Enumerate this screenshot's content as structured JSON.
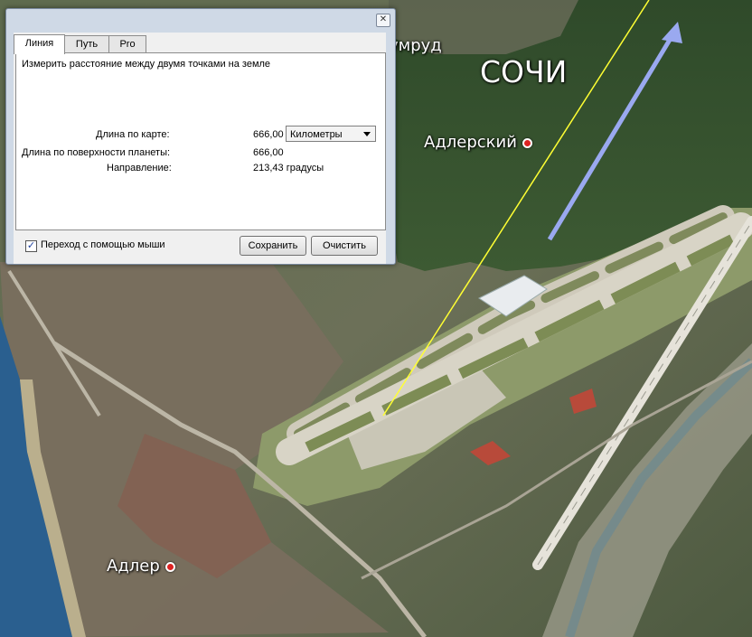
{
  "map": {
    "labels": {
      "city": "СОЧИ",
      "district": "Адлерский",
      "town": "Адлер",
      "partial": "умруд"
    },
    "colors": {
      "measure_line": "#ffff33",
      "arrow": "#9aa9f0",
      "sea": "#2a5f8f"
    }
  },
  "dialog": {
    "close_label": "✕",
    "tabs": [
      {
        "label": "Линия",
        "active": true
      },
      {
        "label": "Путь",
        "active": false
      },
      {
        "label": "Pro",
        "active": false
      }
    ],
    "description": "Измерить расстояние между двумя точками на земле",
    "map_length_label": "Длина по карте:",
    "map_length_value": "666,00",
    "unit_selected": "Километры",
    "surface_length_label": "Длина по поверхности планеты:",
    "surface_length_value": "666,00",
    "heading_label": "Направление:",
    "heading_value": "213,43 градусы",
    "mouse_nav_label": "Переход с помощью мыши",
    "mouse_nav_checked": true,
    "save_label": "Сохранить",
    "clear_label": "Очистить"
  }
}
